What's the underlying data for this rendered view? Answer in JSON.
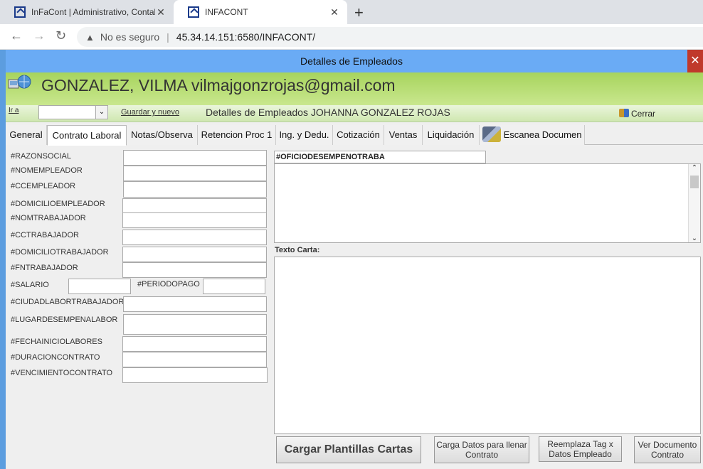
{
  "browser": {
    "tabs": [
      {
        "title": "InFaCont | Administrativo, Contab",
        "close": "✕"
      },
      {
        "title": "INFACONT",
        "close": "✕"
      }
    ],
    "new_tab": "+",
    "security": "No es seguro",
    "url": "45.34.14.151:6580/INFACONT/"
  },
  "window": {
    "title": "Detalles de Empleados",
    "close": "✕"
  },
  "banner": {
    "name": "GONZALEZ, VILMA vilmajgonzrojas@gmail.com"
  },
  "toolbar": {
    "ir_a": "Ir a",
    "combo_value": "",
    "guardar": "Guardar y nuevo",
    "subtitle": "Detalles de Empleados JOHANNA GONZALEZ ROJAS",
    "cerrar": "Cerrar"
  },
  "tabs": [
    {
      "label": "General"
    },
    {
      "label": "Contrato Laboral"
    },
    {
      "label": "Notas/Observa"
    },
    {
      "label": "Retencion Proc 1"
    },
    {
      "label": "Ing. y Dedu."
    },
    {
      "label": "Cotización"
    },
    {
      "label": "Ventas"
    },
    {
      "label": "Liquidación"
    },
    {
      "label": "Escanea Documen"
    }
  ],
  "fields": {
    "razonsocial": {
      "label": "#RAZONSOCIAL",
      "value": ""
    },
    "nomempleador": {
      "label": "#NOMEMPLEADOR",
      "value": ""
    },
    "ccempleador": {
      "label": "#CCEMPLEADOR",
      "value": ""
    },
    "domicilioempleador": {
      "label": "#DOMICILIOEMPLEADOR",
      "value": ""
    },
    "nomtrabajador": {
      "label": "#NOMTRABAJADOR",
      "value": ""
    },
    "cctrabajador": {
      "label": "#CCTRABAJADOR",
      "value": ""
    },
    "domiciliotrabajador": {
      "label": "#DOMICILIOTRABAJADOR",
      "value": ""
    },
    "fntrabajador": {
      "label": "#FNTRABAJADOR",
      "value": ""
    },
    "salario": {
      "label": "#SALARIO",
      "value": ""
    },
    "periodopago": {
      "label": "#PERIODOPAGO",
      "value": ""
    },
    "ciudadlabor": {
      "label": "#CIUDADLABORTRABAJADOR",
      "value": ""
    },
    "lugardesempenalabor": {
      "label": "#LUGARDESEMPENALABOR",
      "value": ""
    },
    "fechainicio": {
      "label": "#FECHAINICIOLABORES",
      "value": ""
    },
    "duracion": {
      "label": "#DURACIONCONTRATO",
      "value": ""
    },
    "vencimiento": {
      "label": "#VENCIMIENTOCONTRATO",
      "value": ""
    }
  },
  "oficio": {
    "label": "#OFICIODESEMPENOTRABA",
    "value": ""
  },
  "texto_carta": {
    "label": "Texto Carta:",
    "value": ""
  },
  "buttons": {
    "cargar": "Cargar Plantillas Cartas",
    "carga_datos": "Carga Datos para llenar Contrato",
    "reemplaza": "Reemplaza Tag x Datos Empleado",
    "ver_documento": "Ver Documento Contrato"
  },
  "scroll": {
    "up": "⌃",
    "down": "⌄"
  },
  "combo_arrow": "⌄"
}
